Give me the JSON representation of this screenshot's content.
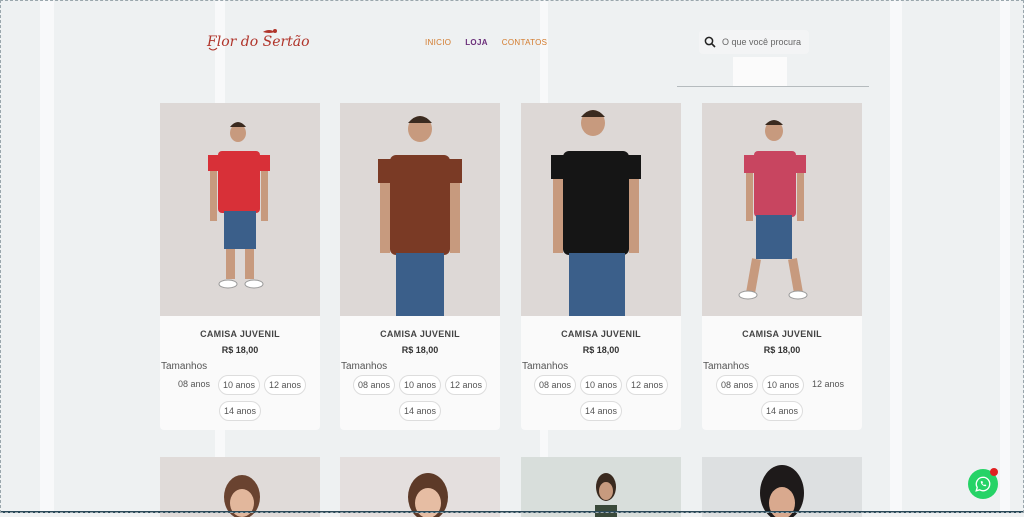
{
  "brand": {
    "logo_text": "Flor do Sertão"
  },
  "nav": [
    {
      "label": "INICIO",
      "active": false
    },
    {
      "label": "LOJA",
      "active": true
    },
    {
      "label": "CONTATOS",
      "active": false
    }
  ],
  "search": {
    "placeholder": "O que você procura"
  },
  "products": [
    {
      "title": "CAMISA JUVENIL",
      "price": "R$ 18,00",
      "sizes_label": "Tamanhos",
      "sizes": [
        "08 anos",
        "10 anos",
        "12 anos",
        "14 anos"
      ],
      "shirt_color": "#d83038",
      "photo_bg": "#e0dad8"
    },
    {
      "title": "CAMISA JUVENIL",
      "price": "R$ 18,00",
      "sizes_label": "Tamanhos",
      "sizes": [
        "08 anos",
        "10 anos",
        "12 anos",
        "14 anos"
      ],
      "shirt_color": "#7a3a25",
      "photo_bg": "#e1dcd9"
    },
    {
      "title": "CAMISA JUVENIL",
      "price": "R$ 18,00",
      "sizes_label": "Tamanhos",
      "sizes": [
        "08 anos",
        "10 anos",
        "12 anos",
        "14 anos"
      ],
      "shirt_color": "#151515",
      "photo_bg": "#e2dedd"
    },
    {
      "title": "CAMISA JUVENIL",
      "price": "R$ 18,00",
      "sizes_label": "Tamanhos",
      "sizes": [
        "08 anos",
        "10 anos",
        "12 anos",
        "14 anos"
      ],
      "shirt_color": "#c84560",
      "photo_bg": "#dcd7d6"
    }
  ],
  "next_row_photo_bgs": [
    "#e0dbd9",
    "#e4dfde",
    "#d8dedb",
    "#dde0e1"
  ],
  "colors": {
    "accent": "#d37a2b",
    "active_nav": "#6b2f7a",
    "whatsapp": "#25d366",
    "badge": "#e02020"
  }
}
